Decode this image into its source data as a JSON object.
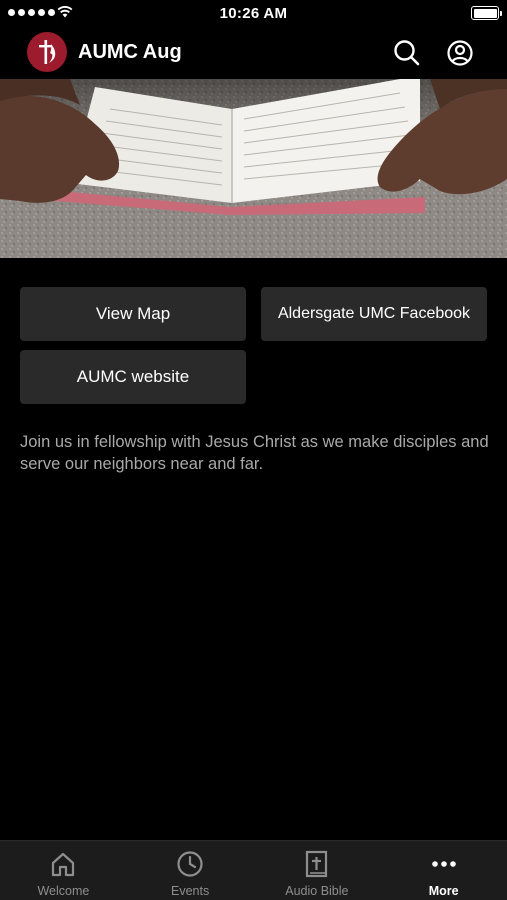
{
  "status_bar": {
    "time": "10:26 AM",
    "signal_icon": "signal-dots-icon",
    "wifi_icon": "wifi-icon",
    "battery_icon": "battery-full-icon"
  },
  "nav": {
    "title": "AUMC Aug",
    "logo_icon": "cross-and-flame-icon",
    "search_icon": "search-icon",
    "account_icon": "account-icon"
  },
  "hero": {
    "description_icon": "open-bible-photo"
  },
  "buttons": {
    "view_map": "View Map",
    "facebook": "Aldersgate UMC Facebook",
    "website": "AUMC website"
  },
  "description": "Join us in fellowship with Jesus Christ as we make disciples and serve our neighbors near and far.",
  "tabs": [
    {
      "label": "Welcome",
      "icon": "home-icon",
      "active": false
    },
    {
      "label": "Events",
      "icon": "clock-icon",
      "active": false
    },
    {
      "label": "Audio Bible",
      "icon": "bible-icon",
      "active": false
    },
    {
      "label": "More",
      "icon": "more-icon",
      "active": true
    }
  ],
  "colors": {
    "background": "#000000",
    "brand": "#9c1c2e",
    "button": "#2a2a2a",
    "tab_bar": "#1c1c1c",
    "muted_text": "#a9a9a9"
  }
}
